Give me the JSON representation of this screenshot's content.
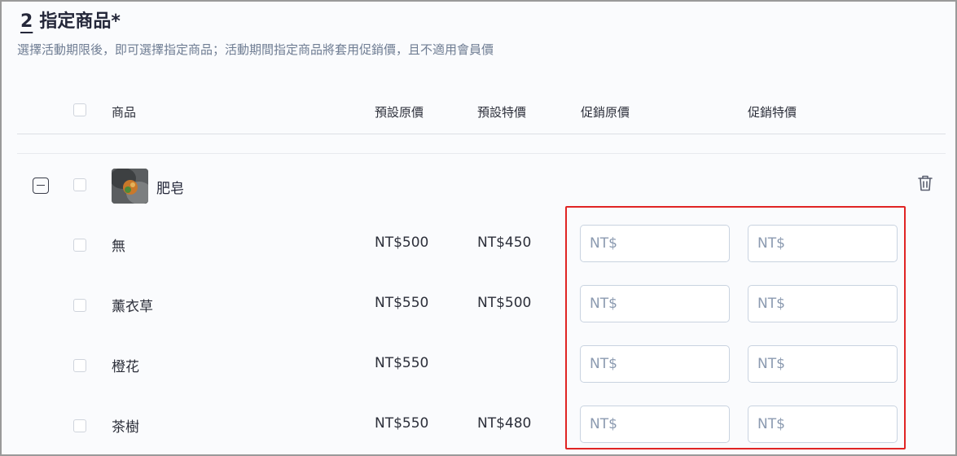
{
  "section": {
    "number": "2",
    "title": "指定商品*",
    "description": "選擇活動期限後，即可選擇指定商品；活動期間指定商品將套用促銷價，且不適用會員價"
  },
  "table": {
    "headers": {
      "product": "商品",
      "default_price": "預設原價",
      "default_sale": "預設特價",
      "promo_price": "促銷原價",
      "promo_sale": "促銷特價"
    }
  },
  "product": {
    "name": "肥皂",
    "variants": [
      {
        "name": "無",
        "default_price": "NT$500",
        "default_sale": "NT$450",
        "promo_price_placeholder": "NT$",
        "promo_sale_placeholder": "NT$"
      },
      {
        "name": "薰衣草",
        "default_price": "NT$550",
        "default_sale": "NT$500",
        "promo_price_placeholder": "NT$",
        "promo_sale_placeholder": "NT$"
      },
      {
        "name": "橙花",
        "default_price": "NT$550",
        "default_sale": "",
        "promo_price_placeholder": "NT$",
        "promo_sale_placeholder": "NT$"
      },
      {
        "name": "茶樹",
        "default_price": "NT$550",
        "default_sale": "NT$480",
        "promo_price_placeholder": "NT$",
        "promo_sale_placeholder": "NT$"
      }
    ]
  },
  "colors": {
    "highlight": "#e02424",
    "input_border": "#c9d3e0",
    "placeholder": "#8b9ab0"
  }
}
